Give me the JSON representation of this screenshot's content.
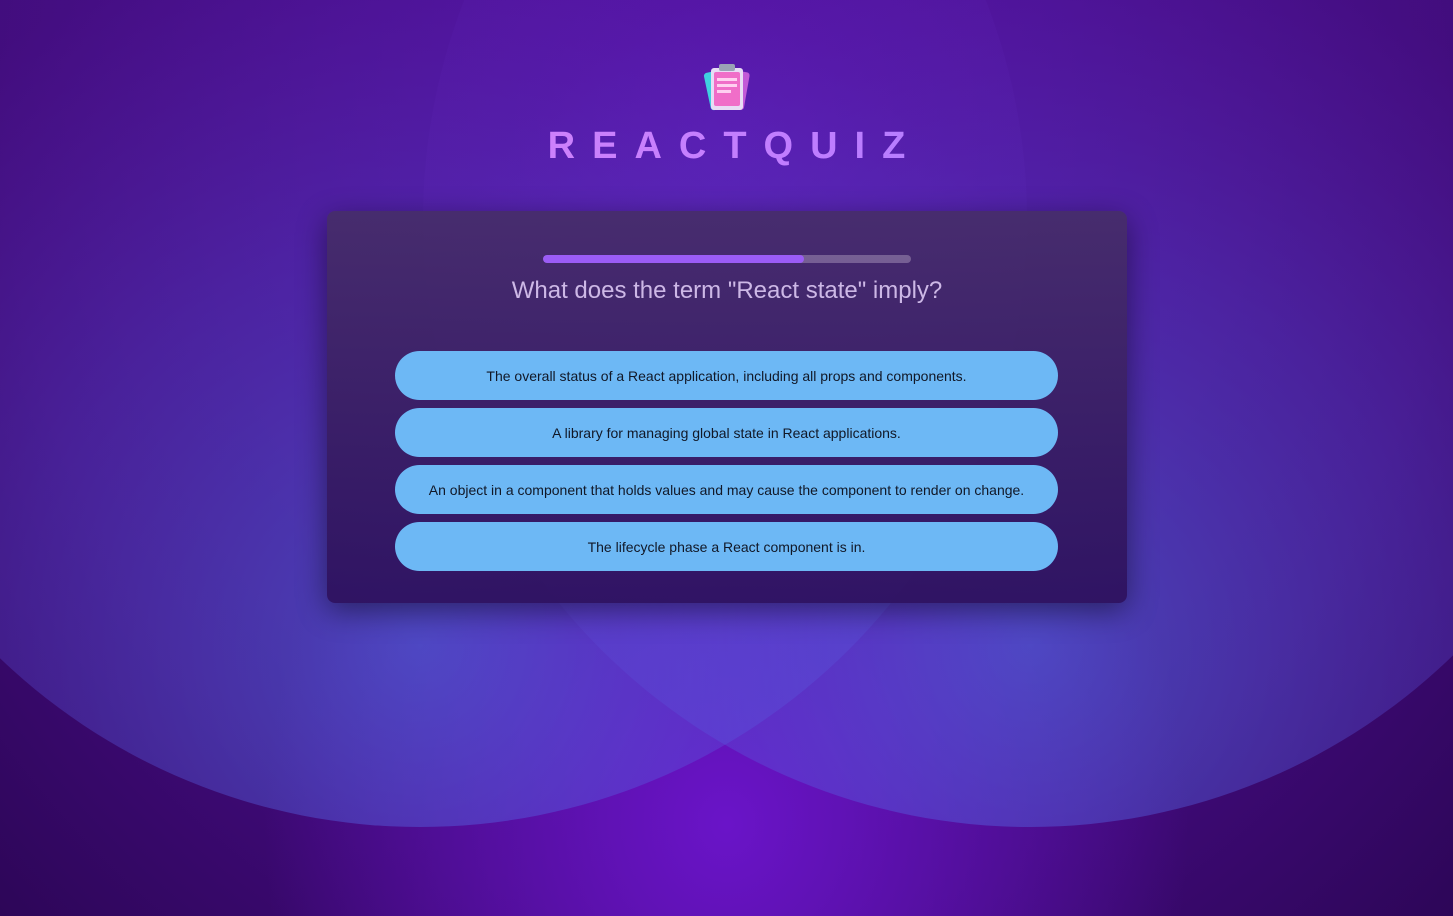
{
  "app": {
    "title": "REACTQUIZ",
    "logo_icon": "clipboard-icon"
  },
  "quiz": {
    "progress_fraction": 0.71,
    "question": "What does the term \"React state\" imply?",
    "answers": [
      "The overall status of a React application, including all props and components.",
      "A library for managing global state in React applications.",
      "An object in a component that holds values and may cause the component to render on change.",
      "The lifecycle phase a React component is in."
    ]
  },
  "colors": {
    "background": "#4a0f96",
    "answer_button": "#6db8f5",
    "progress_fill": "#9b5cf6",
    "title_gradient_start": "#e98bf5",
    "title_gradient_end": "#8c7cff"
  }
}
